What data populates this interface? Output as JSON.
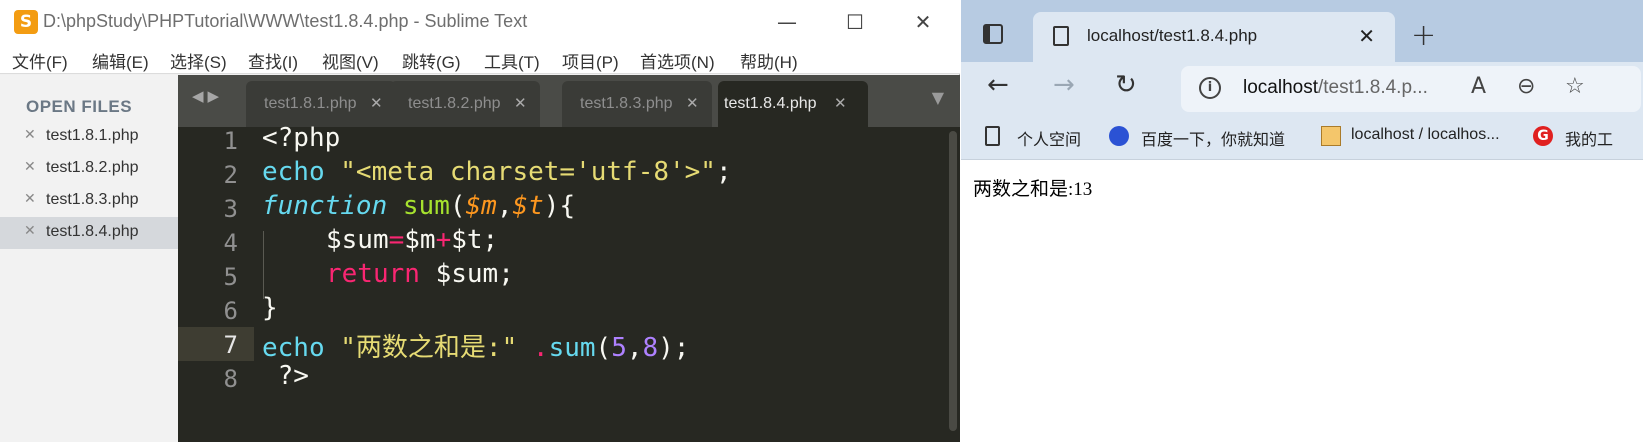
{
  "sublime": {
    "title": "D:\\phpStudy\\PHPTutorial\\WWW\\test1.8.4.php - Sublime Text",
    "controls": {
      "minimize": "—",
      "maximize": "☐",
      "close": "✕"
    },
    "menu": [
      "文件(F)",
      "编辑(E)",
      "选择(S)",
      "查找(I)",
      "视图(V)",
      "跳转(G)",
      "工具(T)",
      "项目(P)",
      "首选项(N)",
      "帮助(H)"
    ],
    "sidebar": {
      "header": "OPEN FILES",
      "files": [
        "test1.8.1.php",
        "test1.8.2.php",
        "test1.8.3.php",
        "test1.8.4.php"
      ],
      "active": "test1.8.4.php"
    },
    "tabs": [
      "test1.8.1.php",
      "test1.8.2.php",
      "test1.8.3.php",
      "test1.8.4.php"
    ],
    "line_numbers": [
      "1",
      "2",
      "3",
      "4",
      "5",
      "6",
      "7",
      "8"
    ],
    "code": {
      "l1": "<?php",
      "l2_kw": "echo",
      "l2_str": " \"<meta charset='utf-8'>\"",
      "l2_end": ";",
      "l3_kw": "function",
      "l3_fn": " sum",
      "l3_p1": "(",
      "l3_arg1": "$m",
      "l3_comma": ",",
      "l3_arg2": "$t",
      "l3_end": "){",
      "l4_a": "$sum",
      "l4_eq": "=",
      "l4_b": "$m",
      "l4_plus": "+",
      "l4_c": "$t;",
      "l5_kw": "return",
      "l5_rest": " $sum;",
      "l6": "}",
      "l7_kw": "echo",
      "l7_str": " \"两数之和是:\"",
      "l7_dot": " .",
      "l7_fn": "sum",
      "l7_p1": "(",
      "l7_n1": "5",
      "l7_comma": ",",
      "l7_n2": "8",
      "l7_end": ");",
      "l8": " ?>"
    },
    "colors": {
      "bg": "#272822",
      "keyword": "#66d9ef",
      "string": "#e6db74",
      "operator": "#f92672",
      "function": "#a6e22e",
      "param": "#fd971f",
      "number": "#ae81ff"
    }
  },
  "browser": {
    "tab_title": "localhost/test1.8.4.php",
    "url_host": "localhost",
    "url_path": "/test1.8.4.p...",
    "favorites": [
      "个人空间",
      "百度一下，你就知道",
      "localhost / localhos...",
      "我的工"
    ],
    "output": "两数之和是:13"
  }
}
